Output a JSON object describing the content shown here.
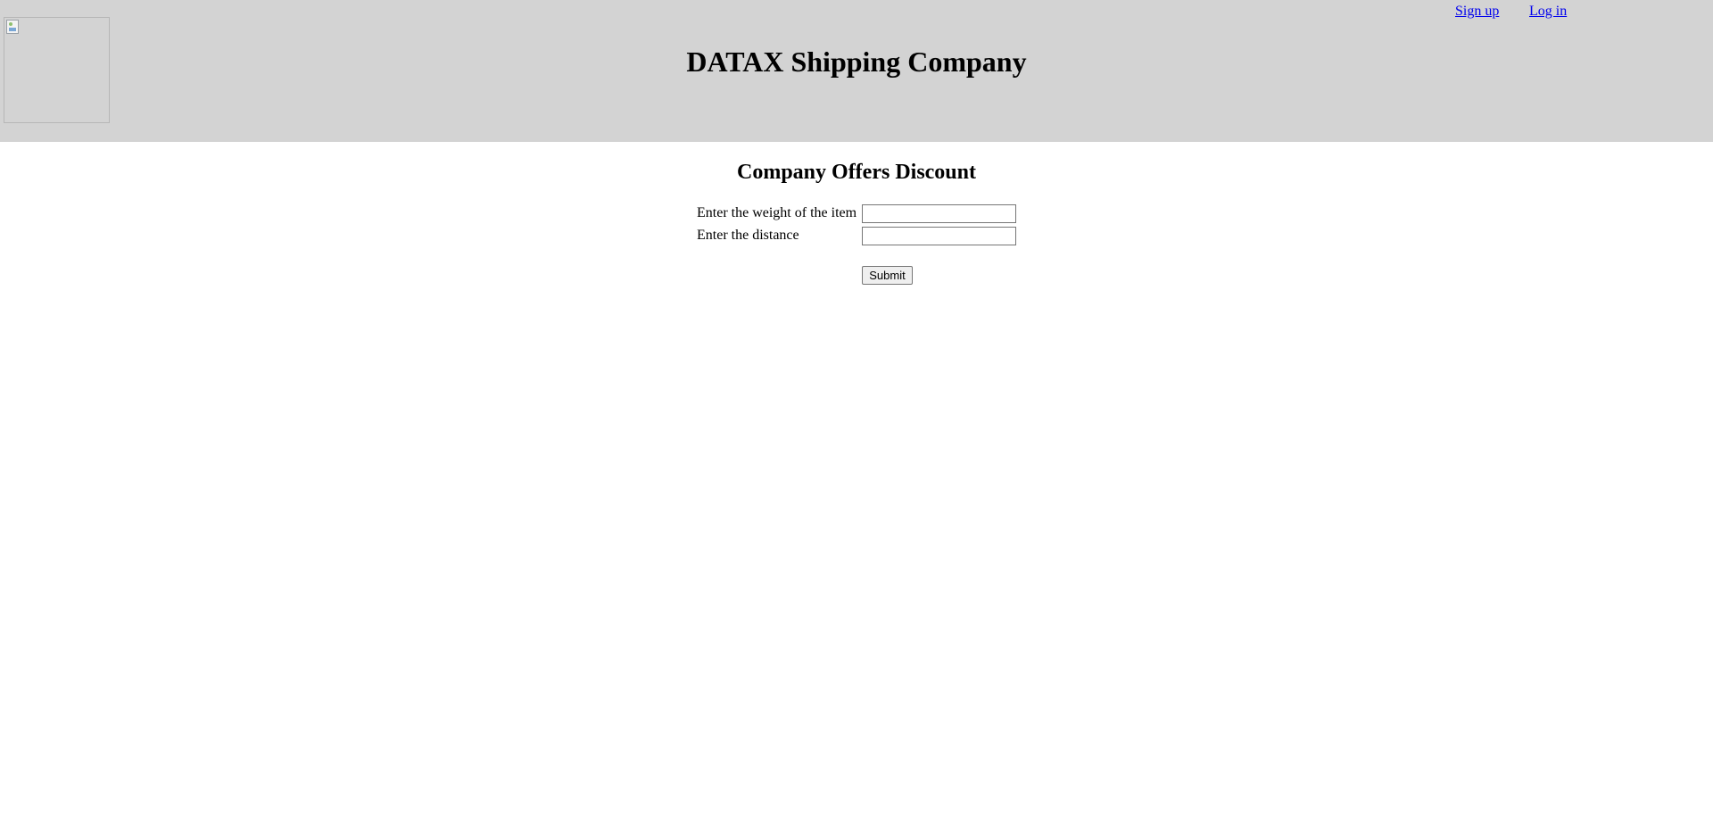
{
  "header": {
    "title": "DATAX Shipping Company",
    "logo_icon": "broken-image-icon",
    "links": {
      "signup": "Sign up",
      "login": "Log in"
    },
    "background": "#d3d3d3",
    "link_color": "#0000ee"
  },
  "main": {
    "heading": "Company Offers Discount",
    "form": {
      "weight_label": "Enter the weight of the item",
      "weight_value": "",
      "distance_label": "Enter the distance",
      "distance_value": "",
      "submit_label": "Submit"
    }
  }
}
